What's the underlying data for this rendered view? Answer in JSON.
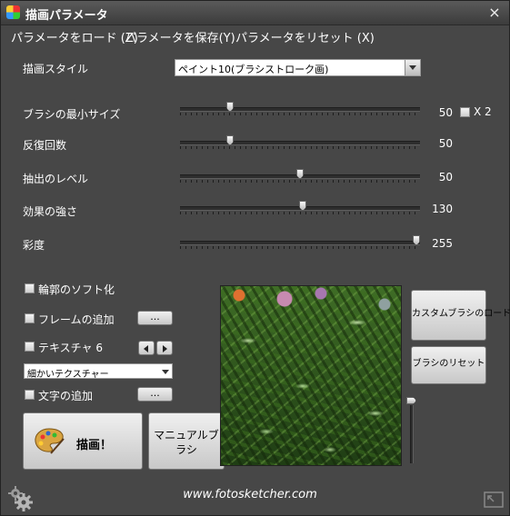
{
  "window": {
    "title": "描画パラメータ",
    "close_symbol": "×"
  },
  "menu": {
    "load": "パラメータをロード (Z)",
    "save": "パラメータを保存(Y)",
    "reset": "パラメータをリセット (X)"
  },
  "style": {
    "label": "描画スタイル",
    "value": "ペイント10(ブラシストローク画)"
  },
  "sliders": [
    {
      "label": "ブラシの最小サイズ",
      "value": "50",
      "fraction": 0.2
    },
    {
      "label": "反復回数",
      "value": "50",
      "fraction": 0.2
    },
    {
      "label": "抽出のレベル",
      "value": "50",
      "fraction": 0.5
    },
    {
      "label": "効果の強さ",
      "value": "130",
      "fraction": 0.51
    },
    {
      "label": "彩度",
      "value": "255",
      "fraction": 1.0
    }
  ],
  "x2": {
    "label": "X 2",
    "checked": false
  },
  "options": {
    "soft_outline": {
      "label": "輪郭のソフト化",
      "checked": false
    },
    "add_frame": {
      "label": "フレームの追加",
      "checked": false,
      "button": "..."
    },
    "texture": {
      "label": "テキスチャ 6",
      "checked": false
    },
    "texture_select": "細かいテクスチャー",
    "add_text": {
      "label": "文字の追加",
      "checked": false,
      "button": "..."
    }
  },
  "buttons": {
    "paint": "描画！",
    "manual_brush": "マニュアルブラシ",
    "custom_brush_load": "カスタムブラシのロード",
    "brush_reset": "ブラシのリセット"
  },
  "footer": {
    "website": "www.fotosketcher.com"
  },
  "icons": {
    "app": "app-palette-icon",
    "gear": "gear-icon",
    "palette": "palette-icon",
    "resize": "resize-icon"
  }
}
